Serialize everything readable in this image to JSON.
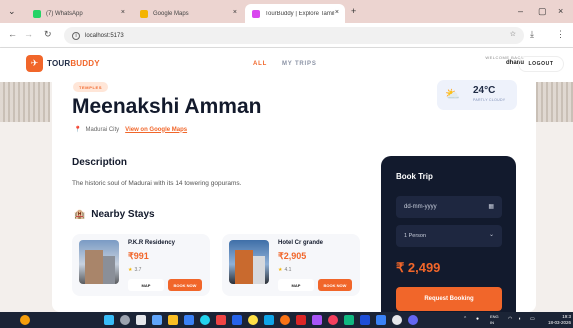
{
  "browser": {
    "tabs": [
      {
        "label": "(7) WhatsApp",
        "color": "#25d366"
      },
      {
        "label": "Google Maps",
        "color": "#f4b400"
      },
      {
        "label": "TourBuddy | Explore Tamil Nadu",
        "color": "#d946ef"
      }
    ],
    "new_tab": "+",
    "url": "localhost:5173"
  },
  "app": {
    "logo_part1": "TOUR",
    "logo_part2": "BUDDY",
    "nav": [
      "ALL",
      "MY TRIPS"
    ],
    "welcome_label": "WELCOME BACK",
    "username": "dhanu",
    "logout": "LOGOUT"
  },
  "place": {
    "category": "TEMPLES",
    "title": "Meenakshi Amman",
    "city": "Madurai City",
    "map_link": "View on Google Maps",
    "weather_temp": "24°C",
    "weather_cond": "PARTLY CLOUDY",
    "desc_heading": "Description",
    "description": "The historic soul of Madurai with its 14 towering gopurams.",
    "stays_heading": "Nearby Stays"
  },
  "stays": [
    {
      "name": "P.K.R Residency",
      "price": "₹991",
      "rating": "3.7",
      "map": "MAP",
      "book": "BOOK NOW"
    },
    {
      "name": "Hotel Cr grande",
      "price": "₹2,905",
      "rating": "4.1",
      "map": "MAP",
      "book": "BOOK NOW"
    }
  ],
  "booking": {
    "title": "Book Trip",
    "date_placeholder": "dd-mm-yyyy",
    "persons": "1 Person",
    "total": "₹ 2,499",
    "request": "Request Booking"
  },
  "taskbar": {
    "lang": "ENG",
    "region": "IN",
    "time": "19:3",
    "date": "18-03-2026"
  },
  "colors": {
    "accent": "#f1662a",
    "dark": "#121a2d"
  }
}
